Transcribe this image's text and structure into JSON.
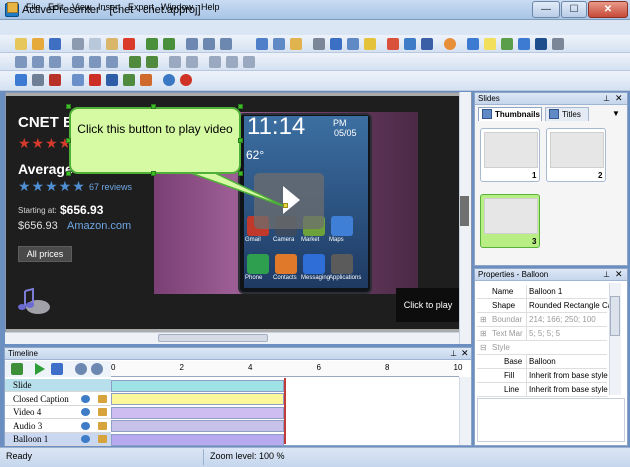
{
  "window": {
    "title": "ActivePresenter - [cnet - cnet.approj]",
    "min": "—",
    "max": "☐",
    "close": "✕"
  },
  "menu": [
    "File",
    "Edit",
    "View",
    "Insert",
    "Export",
    "Window",
    "Help"
  ],
  "slide": {
    "product_title": "CNET Edit",
    "editor_stars": "★★★★",
    "average_label": "Average u",
    "user_stars": "★★★★★",
    "reviews": "67 reviews",
    "starting_at_label": "Starting at:",
    "starting_price": "$656.93",
    "amazon_price": "$656.93",
    "amazon_name": "Amazon.com",
    "all_prices": "All prices",
    "click_to_play": "Click to play",
    "phone_time": "11:14",
    "phone_ampm": "PM",
    "phone_date": "05/05",
    "phone_temp": "62°",
    "apps": [
      {
        "label": "Gmail",
        "color": "#c0392b"
      },
      {
        "label": "Camera",
        "color": "#3b4a5e"
      },
      {
        "label": "Market",
        "color": "#6da23a"
      },
      {
        "label": "Maps",
        "color": "#3f7fd6"
      },
      {
        "label": "Phone",
        "color": "#2e9e4f"
      },
      {
        "label": "Contacts",
        "color": "#e07a2a"
      },
      {
        "label": "Messaging",
        "color": "#2f6ed6"
      },
      {
        "label": "Applications",
        "color": "#5b5b5b"
      }
    ]
  },
  "balloon": {
    "text": "Click this button to play video"
  },
  "slides_panel": {
    "title": "Slides",
    "tabs": [
      "Thumbnails",
      "Titles"
    ],
    "thumbnails": [
      "1",
      "2",
      "3"
    ]
  },
  "properties_panel": {
    "title": "Properties - Balloon",
    "rows": [
      {
        "name": "Name",
        "value": "Balloon 1"
      },
      {
        "name": "Shape",
        "value": "Rounded Rectangle Ca"
      },
      {
        "name": "Boundar",
        "value": "214; 166; 250; 100"
      },
      {
        "name": "Text Mar",
        "value": "5; 5; 5; 5"
      },
      {
        "name": "Style",
        "value": ""
      },
      {
        "name": "Base",
        "value": "Balloon"
      },
      {
        "name": "Fill",
        "value": "Inherit from base style"
      },
      {
        "name": "Line",
        "value": "Inherit from base style"
      }
    ]
  },
  "timeline": {
    "title": "Timeline",
    "ruler": [
      "0",
      "2",
      "4",
      "6",
      "8",
      "10"
    ],
    "rows": [
      {
        "label": "Slide",
        "bar_color": "#9fe3e6",
        "bar_end": 1.0
      },
      {
        "label": "Closed Caption",
        "bar_color": "#fbf79a",
        "bar_end": 1.0
      },
      {
        "label": "Video 4",
        "bar_color": "#cdbdf0",
        "bar_end": 1.0
      },
      {
        "label": "Audio 3",
        "bar_color": "#c8c1ea",
        "bar_end": 1.0
      },
      {
        "label": "Balloon 1",
        "bar_color": "#b7aaf0",
        "bar_end": 1.0
      }
    ]
  },
  "status": {
    "ready": "Ready",
    "zoom": "Zoom level:  100 %"
  },
  "colors": {
    "accent": "#4fb038",
    "balloon_fill": "#d6f9a4",
    "selected_thumb": "#b8ee84"
  }
}
